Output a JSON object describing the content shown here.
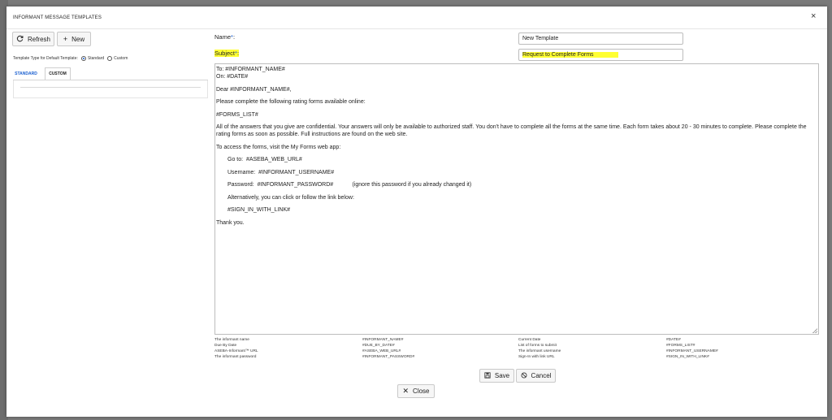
{
  "dialog": {
    "title": "INFORMANT MESSAGE TEMPLATES",
    "close_glyph": "×"
  },
  "toolbar": {
    "refresh_label": "Refresh",
    "new_label": "New"
  },
  "template_type": {
    "label": "Template Type for Default Template:",
    "options": [
      "Standard",
      "Custom"
    ],
    "selected": "Standard"
  },
  "tabs": [
    "STANDARD",
    "CUSTOM"
  ],
  "form": {
    "name_label": "Name",
    "name_value": "New Template",
    "subject_label": "Subject",
    "subject_value": "Request to Complete Forms",
    "required_mark": "*",
    "label_suffix": ":"
  },
  "message": {
    "lines": [
      {
        "text": "To: #INFORMANT_NAME#",
        "indent": false
      },
      {
        "text": "On: #DATE#",
        "indent": false
      },
      {
        "text": "Dear #INFORMANT_NAME#,",
        "indent": false
      },
      {
        "text": "Please complete the following rating forms available online:",
        "indent": false
      },
      {
        "text": "#FORMS_LIST#",
        "indent": false
      },
      {
        "text": "All of the answers that you give are confidential. Your answers will only be available to authorized staff. You don't have to complete all the forms at the same time. Each form takes about 20 - 30 minutes to complete. Please complete the rating forms as soon as possible. Full instructions are found on the web site.",
        "indent": false
      },
      {
        "text": "To access the forms, visit the My Forms web app:",
        "indent": false
      },
      {
        "text": "Go to:  #ASEBA_WEB_URL#",
        "indent": true
      },
      {
        "text": "Username:  #INFORMANT_USERNAME#",
        "indent": true
      },
      {
        "text": "Password:  #INFORMANT_PASSWORD#            (ignore this password if you already changed it)",
        "indent": true
      },
      {
        "text": "Alternatively, you can click or follow the link below:",
        "indent": true
      },
      {
        "text": "#SIGN_IN_WITH_LINK#",
        "indent": true
      },
      {
        "text": "Thank you.",
        "indent": false
      }
    ]
  },
  "placeholders": {
    "col1_names": [
      "The informant name",
      "Due By Date",
      "ASEBA-Informant™ URL",
      "The informant password"
    ],
    "col1_tokens": [
      "#INFORMANT_NAME#",
      "#DUE_BY_DATE#",
      "#ASEBA_WEB_URL#",
      "#INFORMANT_PASSWORD#"
    ],
    "col2_names": [
      "Current Date",
      "List of forms to submit",
      "The informant username",
      "Sign-In with link URL"
    ],
    "col2_tokens": [
      "#DATE#",
      "#FORMS_LIST#",
      "#INFORMANT_USERNAME#",
      "#SIGN_IN_WITH_LINK#"
    ]
  },
  "actions": {
    "save_label": "Save",
    "cancel_label": "Cancel",
    "close_label": "Close"
  },
  "colors": {
    "accent": "#1a5fd0",
    "highlight": "#ffff33",
    "backdrop": "#7a7a7a"
  }
}
